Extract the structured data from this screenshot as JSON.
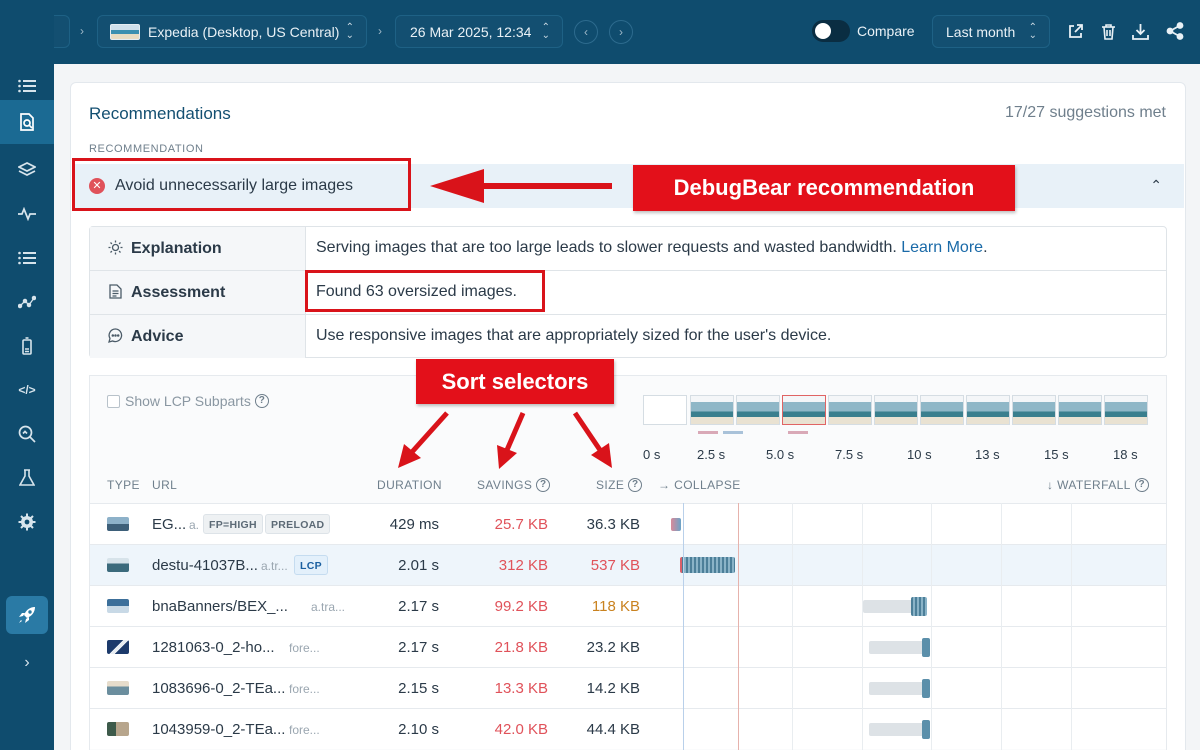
{
  "topbar": {
    "site_label": "Expedia (Desktop, US Central)",
    "date_label": "26 Mar 2025, 12:34",
    "compare_label": "Compare",
    "range_label": "Last month",
    "icons": [
      "external-link-icon",
      "trash-icon",
      "download-icon",
      "share-icon"
    ]
  },
  "sidebar": {
    "items": [
      "list-icon",
      "page-search-icon",
      "layers-icon",
      "pulse-icon",
      "list-icon",
      "graph-icon",
      "battery-icon",
      "code-icon",
      "zoom-icon",
      "flask-icon",
      "gear-icon"
    ],
    "active_index": 1
  },
  "recommendations": {
    "title": "Recommendations",
    "count": "17/27 suggestions met",
    "column_header": "RECOMMENDATION",
    "item": "Avoid unnecessarily large images"
  },
  "details": {
    "explanation_label": "Explanation",
    "explanation_text": "Serving images that are too large leads to slower requests and wasted bandwidth.",
    "learn_more": "Learn More",
    "assessment_label": "Assessment",
    "assessment_text": "Found 63 oversized images.",
    "advice_label": "Advice",
    "advice_text": "Use responsive images that are appropriately sized for the user's device."
  },
  "controls": {
    "lcp_label": "Show LCP Subparts"
  },
  "timeline": [
    "0 s",
    "2.5 s",
    "5.0 s",
    "7.5 s",
    "10 s",
    "13 s",
    "15 s",
    "18 s"
  ],
  "table": {
    "headers": {
      "type": "TYPE",
      "url": "URL",
      "duration": "DURATION",
      "savings": "SAVINGS",
      "size": "SIZE",
      "collapse": "→ COLLAPSE",
      "waterfall": "↓ WATERFALL"
    },
    "rows": [
      {
        "url": "EG...",
        "host": "a.",
        "badges": [
          "FP=HIGH",
          "PRELOAD"
        ],
        "duration": "429 ms",
        "savings": "25.7 KB",
        "size": "36.3 KB",
        "size_color": "#2b3a48"
      },
      {
        "url": "destu-41037B...",
        "host": "a.tr...",
        "badges": [
          "LCP"
        ],
        "duration": "2.01 s",
        "savings": "312 KB",
        "size": "537 KB",
        "size_color": "#e0525a"
      },
      {
        "url": "bnaBanners/BEX_...",
        "host": "a.tra...",
        "badges": [],
        "duration": "2.17 s",
        "savings": "99.2 KB",
        "size": "118 KB",
        "size_color": "#c9821f"
      },
      {
        "url": "1281063-0_2-ho...",
        "host": "fore...",
        "badges": [],
        "duration": "2.17 s",
        "savings": "21.8 KB",
        "size": "23.2 KB",
        "size_color": "#2b3a48"
      },
      {
        "url": "1083696-0_2-TEa...",
        "host": "fore...",
        "badges": [],
        "duration": "2.15 s",
        "savings": "13.3 KB",
        "size": "14.2 KB",
        "size_color": "#2b3a48"
      },
      {
        "url": "1043959-0_2-TEa...",
        "host": "fore...",
        "badges": [],
        "duration": "2.10 s",
        "savings": "42.0 KB",
        "size": "44.4 KB",
        "size_color": "#2b3a48"
      }
    ]
  },
  "annotations": {
    "recommendation_callout": "DebugBear recommendation",
    "sort_callout": "Sort selectors",
    "color": "#e3101a"
  }
}
